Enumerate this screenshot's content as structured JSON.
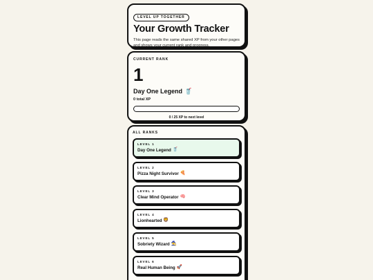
{
  "hero": {
    "badge": "LEVEL UP TOGETHER",
    "title": "Your Growth Tracker",
    "description": "This page reads the same shared XP from your other pages and shows your current rank and progress."
  },
  "current_rank": {
    "label": "CURRENT RANK",
    "number": "1",
    "name": "Day One Legend",
    "emoji": "🥤",
    "total_xp": "0 total XP",
    "progress_fraction": 0,
    "progress_text": "0 / 25 XP to next level"
  },
  "all_ranks": {
    "label": "ALL RANKS",
    "items": [
      {
        "level": "LEVEL 1",
        "name": "Day One Legend",
        "emoji": "🥤",
        "active": true
      },
      {
        "level": "LEVEL 2",
        "name": "Pizza Night Survivor",
        "emoji": "🍕",
        "active": false
      },
      {
        "level": "LEVEL 3",
        "name": "Clear Mind Operator",
        "emoji": "🧠",
        "active": false
      },
      {
        "level": "LEVEL 4",
        "name": "Lionhearted",
        "emoji": "🦁",
        "active": false
      },
      {
        "level": "LEVEL 5",
        "name": "Sobriety Wizard",
        "emoji": "🧙",
        "active": false
      },
      {
        "level": "LEVEL 6",
        "name": "Real Human Being",
        "emoji": "🚀",
        "active": false
      }
    ]
  },
  "colors": {
    "background": "#f6f3eb",
    "card": "#fdfcf8",
    "active_rank": "#e8f9ec",
    "ink": "#111111"
  }
}
